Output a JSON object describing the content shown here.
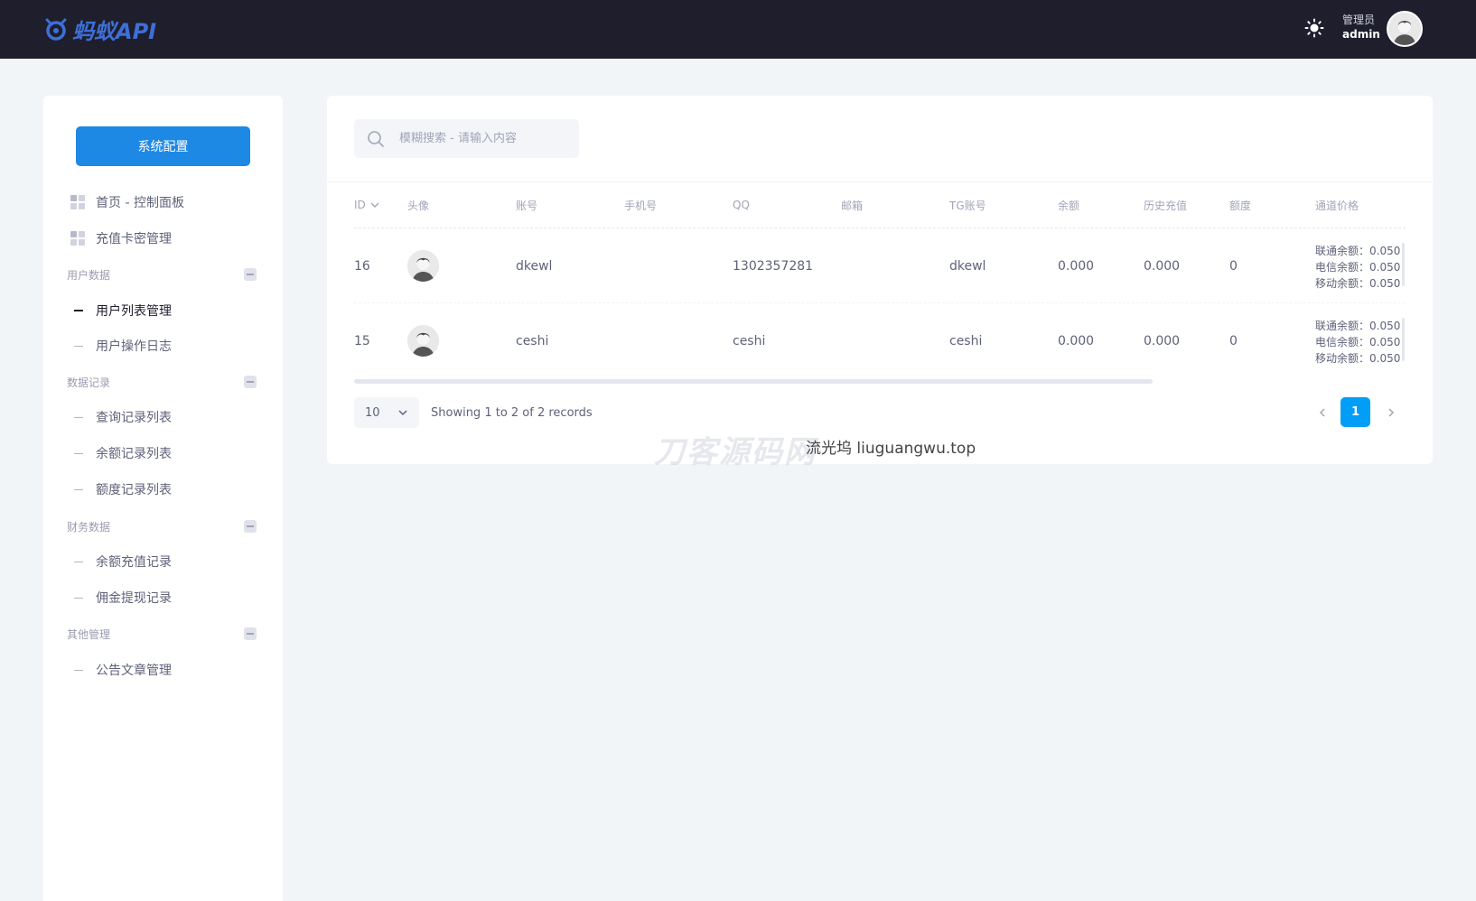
{
  "topbar": {
    "logo_text": "蚂蚁API",
    "theme_icon": "sun-icon",
    "user_role": "管理员",
    "user_name": "admin"
  },
  "sidebar": {
    "config_button": "系统配置",
    "top_items": [
      {
        "label": "首页 - 控制面板",
        "icon": "grid-icon"
      },
      {
        "label": "充值卡密管理",
        "icon": "grid-icon"
      }
    ],
    "sections": [
      {
        "title": "用户数据",
        "items": [
          {
            "label": "用户列表管理",
            "active": true
          },
          {
            "label": "用户操作日志",
            "active": false
          }
        ]
      },
      {
        "title": "数据记录",
        "items": [
          {
            "label": "查询记录列表"
          },
          {
            "label": "余额记录列表"
          },
          {
            "label": "额度记录列表"
          }
        ]
      },
      {
        "title": "财务数据",
        "items": [
          {
            "label": "余额充值记录"
          },
          {
            "label": "佣金提现记录"
          }
        ]
      },
      {
        "title": "其他管理",
        "items": [
          {
            "label": "公告文章管理"
          }
        ]
      }
    ]
  },
  "main": {
    "search_placeholder": "模糊搜索 - 请输入内容",
    "columns": [
      "ID",
      "头像",
      "账号",
      "手机号",
      "QQ",
      "邮箱",
      "TG账号",
      "余额",
      "历史充值",
      "额度",
      "通道价格"
    ],
    "rows": [
      {
        "id": "16",
        "account": "dkewl",
        "phone": "",
        "qq": "1302357281",
        "email": "",
        "tg": "dkewl",
        "balance": "0.000",
        "history": "0.000",
        "quota": "0",
        "prices": [
          "联通余额：0.050",
          "电信余额：0.050",
          "移动余额：0.050"
        ]
      },
      {
        "id": "15",
        "account": "ceshi",
        "phone": "",
        "qq": "ceshi",
        "email": "",
        "tg": "ceshi",
        "balance": "0.000",
        "history": "0.000",
        "quota": "0",
        "prices": [
          "联通余额：0.050",
          "电信余额：0.050",
          "移动余额：0.050"
        ]
      }
    ],
    "page_size": "10",
    "records_text": "Showing 1 to 2 of 2 records",
    "current_page": "1"
  },
  "watermark": {
    "text1": "刀客源码网",
    "text2": "流光坞 liuguangwu.top"
  }
}
